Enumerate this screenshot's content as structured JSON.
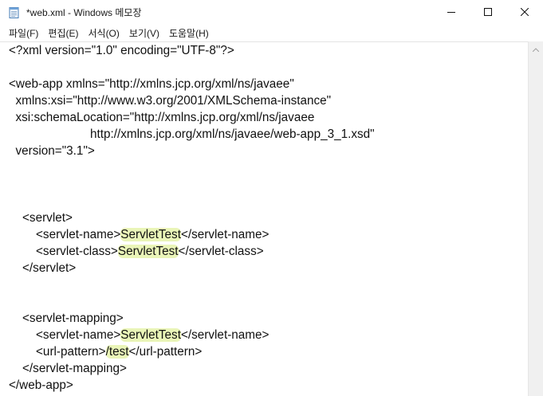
{
  "window": {
    "title": "*web.xml - Windows 메모장",
    "icons": [
      "notepad-icon",
      "minimize-icon",
      "maximize-icon",
      "close-icon"
    ]
  },
  "menu": {
    "items": [
      "파일(F)",
      "편집(E)",
      "서식(O)",
      "보기(V)",
      "도움말(H)"
    ]
  },
  "editor": {
    "lines": [
      [
        {
          "t": "<?xml version=\"1.0\" encoding=\"UTF-8\"?>"
        }
      ],
      [
        {
          "t": ""
        }
      ],
      [
        {
          "t": "<web-app xmlns=\"http://xmlns.jcp.org/xml/ns/javaee\""
        }
      ],
      [
        {
          "t": "  xmlns:xsi=\"http://www.w3.org/2001/XMLSchema-instance\""
        }
      ],
      [
        {
          "t": "  xsi:schemaLocation=\"http://xmlns.jcp.org/xml/ns/javaee"
        }
      ],
      [
        {
          "t": "                        http://xmlns.jcp.org/xml/ns/javaee/web-app_3_1.xsd\""
        }
      ],
      [
        {
          "t": "  version=\"3.1\">"
        }
      ],
      [
        {
          "t": ""
        }
      ],
      [
        {
          "t": ""
        }
      ],
      [
        {
          "t": ""
        }
      ],
      [
        {
          "t": "    <servlet>"
        }
      ],
      [
        {
          "t": "        <servlet-name>"
        },
        {
          "t": "ServletTest",
          "hl": true
        },
        {
          "t": "</servlet-name>"
        }
      ],
      [
        {
          "t": "        <servlet-class>"
        },
        {
          "t": "ServletTest",
          "hl": true
        },
        {
          "t": "</servlet-class>"
        }
      ],
      [
        {
          "t": "    </servlet>"
        }
      ],
      [
        {
          "t": ""
        }
      ],
      [
        {
          "t": ""
        }
      ],
      [
        {
          "t": "    <servlet-mapping>"
        }
      ],
      [
        {
          "t": "        <servlet-name>"
        },
        {
          "t": "ServletTest",
          "hl": true
        },
        {
          "t": "</servlet-name>"
        }
      ],
      [
        {
          "t": "        <url-pattern>"
        },
        {
          "t": "/test",
          "hl": true
        },
        {
          "t": "</url-pattern>"
        }
      ],
      [
        {
          "t": "    </servlet-mapping>"
        }
      ],
      [
        {
          "t": "</web-app>"
        }
      ]
    ]
  },
  "colors": {
    "highlight": "#eaf5b8",
    "text": "#111111"
  }
}
